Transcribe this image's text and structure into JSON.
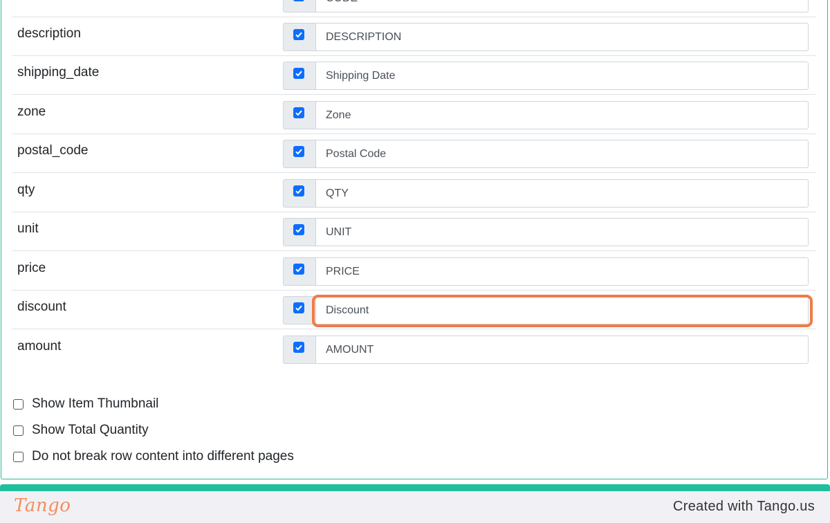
{
  "fields": [
    {
      "name": "",
      "label": "CODE",
      "checked": true
    },
    {
      "name": "description",
      "label": "DESCRIPTION",
      "checked": true
    },
    {
      "name": "shipping_date",
      "label": "Shipping Date",
      "checked": true
    },
    {
      "name": "zone",
      "label": "Zone",
      "checked": true
    },
    {
      "name": "postal_code",
      "label": "Postal Code",
      "checked": true
    },
    {
      "name": "qty",
      "label": "QTY",
      "checked": true
    },
    {
      "name": "unit",
      "label": "UNIT",
      "checked": true
    },
    {
      "name": "price",
      "label": "PRICE",
      "checked": true
    },
    {
      "name": "discount",
      "label": "Discount",
      "checked": true
    },
    {
      "name": "amount",
      "label": "AMOUNT",
      "checked": true
    }
  ],
  "options": [
    {
      "label": "Show Item Thumbnail",
      "checked": false
    },
    {
      "label": "Show Total Quantity",
      "checked": false
    },
    {
      "label": "Do not break row content into different pages",
      "checked": false
    }
  ],
  "footer": {
    "brand": "Tango",
    "credit": "Created with Tango.us"
  },
  "colors": {
    "checkbox": "#0d6efd",
    "highlight": "#f07b46",
    "footer_bar": "#1fbf9d",
    "brand": "#f28e5f"
  }
}
